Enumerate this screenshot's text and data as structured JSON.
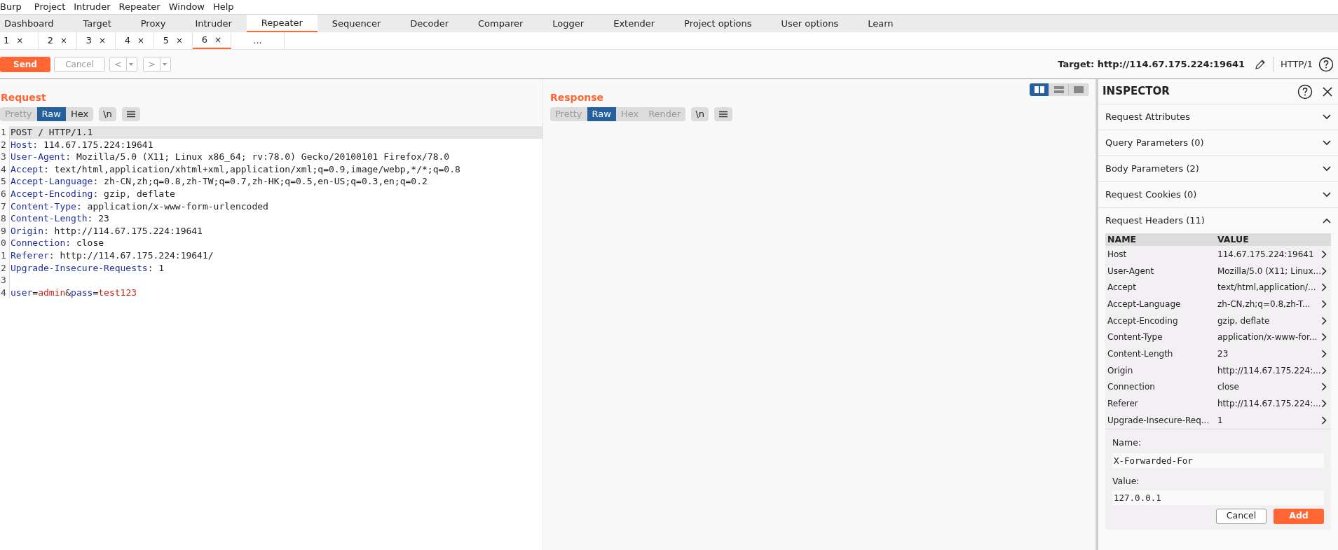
{
  "menu_bar": [
    "Burp",
    "Project",
    "Intruder",
    "Repeater",
    "Window",
    "Help"
  ],
  "main_tabs": [
    {
      "label": "Dashboard",
      "selected": false
    },
    {
      "label": "Target",
      "selected": false
    },
    {
      "label": "Proxy",
      "selected": false
    },
    {
      "label": "Intruder",
      "selected": false
    },
    {
      "label": "Repeater",
      "selected": true
    },
    {
      "label": "Sequencer",
      "selected": false
    },
    {
      "label": "Decoder",
      "selected": false
    },
    {
      "label": "Comparer",
      "selected": false
    },
    {
      "label": "Logger",
      "selected": false
    },
    {
      "label": "Extender",
      "selected": false
    },
    {
      "label": "Project options",
      "selected": false
    },
    {
      "label": "User options",
      "selected": false
    },
    {
      "label": "Learn",
      "selected": false
    }
  ],
  "repeater_tabs": [
    {
      "label": "1",
      "close": "×",
      "selected": false
    },
    {
      "label": "2",
      "close": "×",
      "selected": false
    },
    {
      "label": "3",
      "close": "×",
      "selected": false
    },
    {
      "label": "4",
      "close": "×",
      "selected": false
    },
    {
      "label": "5",
      "close": "×",
      "selected": false
    },
    {
      "label": "6",
      "close": "×",
      "selected": true
    }
  ],
  "more_tabs": "...",
  "toolbar": {
    "send": "Send",
    "cancel": "Cancel",
    "back": "<",
    "forward": ">",
    "target": "Target: http://114.67.175.224:19641",
    "protocol": "HTTP/1"
  },
  "layout_buttons": [
    {
      "kind": "side",
      "selected": true
    },
    {
      "kind": "stacked",
      "selected": false
    },
    {
      "kind": "single",
      "selected": false
    }
  ],
  "request": {
    "title": "Request",
    "view_tabs": [
      {
        "label": "Pretty",
        "selected": false,
        "disabled": true
      },
      {
        "label": "Raw",
        "selected": true,
        "disabled": false
      },
      {
        "label": "Hex",
        "selected": false,
        "disabled": false
      }
    ],
    "newline_button": "\\n",
    "lines": [
      {
        "number": "1",
        "highlighted": true,
        "parts": [
          {
            "text": "POST / HTTP/1.1",
            "kind": "plain"
          }
        ]
      },
      {
        "number": "2",
        "highlighted": false,
        "parts": [
          {
            "text": "Host",
            "kind": "key"
          },
          {
            "text": ": 114.67.175.224:19641",
            "kind": "plain"
          }
        ]
      },
      {
        "number": "3",
        "highlighted": false,
        "parts": [
          {
            "text": "User-Agent",
            "kind": "key"
          },
          {
            "text": ": Mozilla/5.0 (X11; Linux x86_64; rv:78.0) Gecko/20100101 Firefox/78.0",
            "kind": "plain"
          }
        ]
      },
      {
        "number": "4",
        "highlighted": false,
        "parts": [
          {
            "text": "Accept",
            "kind": "key"
          },
          {
            "text": ": text/html,application/xhtml+xml,application/xml;q=0.9,image/webp,*/*;q=0.8",
            "kind": "plain"
          }
        ]
      },
      {
        "number": "5",
        "highlighted": false,
        "parts": [
          {
            "text": "Accept-Language",
            "kind": "key"
          },
          {
            "text": ": zh-CN,zh;q=0.8,zh-TW;q=0.7,zh-HK;q=0.5,en-US;q=0.3,en;q=0.2",
            "kind": "plain"
          }
        ]
      },
      {
        "number": "6",
        "highlighted": false,
        "parts": [
          {
            "text": "Accept-Encoding",
            "kind": "key"
          },
          {
            "text": ": gzip, deflate",
            "kind": "plain"
          }
        ]
      },
      {
        "number": "7",
        "highlighted": false,
        "parts": [
          {
            "text": "Content-Type",
            "kind": "key"
          },
          {
            "text": ": application/x-www-form-urlencoded",
            "kind": "plain"
          }
        ]
      },
      {
        "number": "8",
        "highlighted": false,
        "parts": [
          {
            "text": "Content-Length",
            "kind": "key"
          },
          {
            "text": ": 23",
            "kind": "plain"
          }
        ]
      },
      {
        "number": "9",
        "highlighted": false,
        "parts": [
          {
            "text": "Origin",
            "kind": "key"
          },
          {
            "text": ": http://114.67.175.224:19641",
            "kind": "plain"
          }
        ]
      },
      {
        "number": "0",
        "highlighted": false,
        "parts": [
          {
            "text": "Connection",
            "kind": "key"
          },
          {
            "text": ": close",
            "kind": "plain"
          }
        ]
      },
      {
        "number": "1",
        "highlighted": false,
        "parts": [
          {
            "text": "Referer",
            "kind": "key"
          },
          {
            "text": ": http://114.67.175.224:19641/",
            "kind": "plain"
          }
        ]
      },
      {
        "number": "2",
        "highlighted": false,
        "parts": [
          {
            "text": "Upgrade-Insecure-Requests",
            "kind": "key"
          },
          {
            "text": ": 1",
            "kind": "plain"
          }
        ]
      },
      {
        "number": "3",
        "highlighted": false
      },
      {
        "number": "4",
        "highlighted": false,
        "parts": [
          {
            "text": "user",
            "kind": "key"
          },
          {
            "text": "=",
            "kind": "plain"
          },
          {
            "text": "admin",
            "kind": "value"
          },
          {
            "text": "&",
            "kind": "plain"
          },
          {
            "text": "pass",
            "kind": "key"
          },
          {
            "text": "=",
            "kind": "plain"
          },
          {
            "text": "test123",
            "kind": "value"
          }
        ]
      }
    ]
  },
  "response": {
    "title": "Response",
    "view_tabs": [
      {
        "label": "Pretty",
        "selected": false,
        "disabled": true
      },
      {
        "label": "Raw",
        "selected": true,
        "disabled": false
      },
      {
        "label": "Hex",
        "selected": false,
        "disabled": true
      },
      {
        "label": "Render",
        "selected": false,
        "disabled": true
      }
    ],
    "newline_button": "\\n"
  },
  "inspector": {
    "title": "INSPECTOR",
    "sections": [
      {
        "label": "Request Attributes",
        "expanded": false
      },
      {
        "label": "Query Parameters (0)",
        "expanded": false
      },
      {
        "label": "Body Parameters (2)",
        "expanded": false
      },
      {
        "label": "Request Cookies (0)",
        "expanded": false
      },
      {
        "label": "Request Headers (11)",
        "expanded": true
      }
    ],
    "headers_table": {
      "columns": [
        "NAME",
        "VALUE"
      ],
      "rows": [
        {
          "name": "Host",
          "value": "114.67.175.224:19641"
        },
        {
          "name": "User-Agent",
          "value": "Mozilla/5.0 (X11; Linux..."
        },
        {
          "name": "Accept",
          "value": "text/html,application/..."
        },
        {
          "name": "Accept-Language",
          "value": "zh-CN,zh;q=0.8,zh-T..."
        },
        {
          "name": "Accept-Encoding",
          "value": "gzip, deflate"
        },
        {
          "name": "Content-Type",
          "value": "application/x-www-for..."
        },
        {
          "name": "Content-Length",
          "value": "23"
        },
        {
          "name": "Origin",
          "value": "http://114.67.175.224:..."
        },
        {
          "name": "Connection",
          "value": "close"
        },
        {
          "name": "Referer",
          "value": "http://114.67.175.224:..."
        },
        {
          "name": "Upgrade-Insecure-Req...",
          "value": "1"
        }
      ]
    },
    "add_form": {
      "name_label": "Name:",
      "name_value": "X-Forwarded-For",
      "value_label": "Value:",
      "value_value": "127.0.0.1",
      "cancel": "Cancel",
      "add": "Add"
    }
  }
}
